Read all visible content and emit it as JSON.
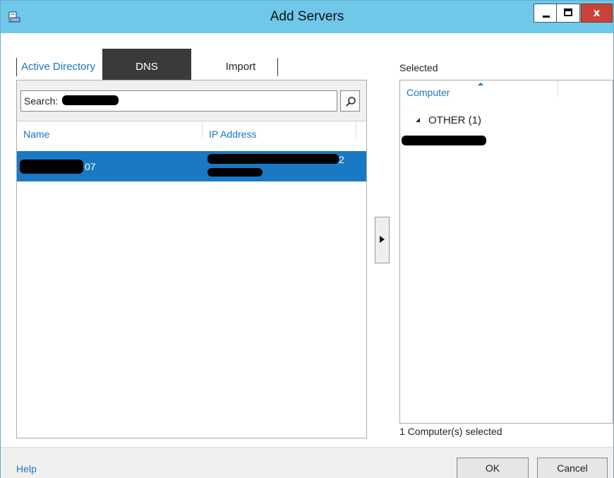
{
  "window": {
    "title": "Add Servers",
    "close_glyph": "x"
  },
  "tabs": {
    "active_directory": "Active Directory",
    "dns": "DNS",
    "import": "Import"
  },
  "search": {
    "label": "Search:",
    "value": "",
    "icon": "search-icon"
  },
  "results": {
    "columns": [
      "Name",
      "IP Address"
    ],
    "rows": [
      {
        "name_suffix": "07",
        "ip_suffix": "2"
      }
    ]
  },
  "selected": {
    "label": "Selected",
    "column": "Computer",
    "group": "OTHER (1)",
    "count_text": "1 Computer(s) selected"
  },
  "footer": {
    "help": "Help",
    "ok": "OK",
    "cancel": "Cancel"
  },
  "colors": {
    "titlebar": "#6fc8ea",
    "accent": "#1a75c0",
    "selection": "#1979c4",
    "close_button": "#c8443a",
    "active_tab": "#3a3a3a"
  }
}
